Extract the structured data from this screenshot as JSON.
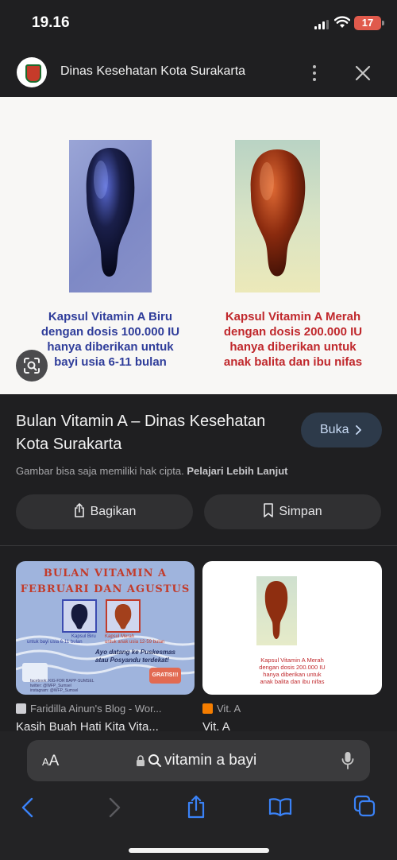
{
  "status_bar": {
    "time": "19.16",
    "battery": "17"
  },
  "site": {
    "name": "Dinas Kesehatan Kota Surakarta"
  },
  "image": {
    "left_caption": [
      "Kapsul Vitamin A Biru",
      "dengan dosis 100.000 IU",
      "hanya diberikan untuk",
      "bayi usia 6-11 bulan"
    ],
    "right_caption": [
      "Kapsul Vitamin A Merah",
      "dengan dosis 200.000 IU",
      "hanya diberikan untuk",
      "anak balita  dan ibu nifas"
    ]
  },
  "result": {
    "title": "Bulan Vitamin A – Dinas Kesehatan Kota Surakarta",
    "open_label": "Buka",
    "notice": "Gambar bisa saja memiliki hak cipta.",
    "notice_link": "Pelajari Lebih Lanjut",
    "share_label": "Bagikan",
    "save_label": "Simpan"
  },
  "related": [
    {
      "source": "Faridilla Ainun's Blog - Wor...",
      "title": "Kasih Buah Hati Kita Vita...",
      "image_text": {
        "line1": "BULAN VITAMIN A",
        "line2": "FEBRUARI DAN AGUSTUS",
        "blue_label": [
          "Kapsul Biru",
          "untuk bayi usia 6-11 bulan"
        ],
        "red_label": [
          "Kapsul Merah",
          "untuk anak usia 12-59 bulan"
        ],
        "note": [
          "Ayo datang ke Puskesmas",
          "atau Posyandu terdekat!"
        ],
        "badge": "GRATIS!!!",
        "credit": [
          "facebook: KIG-FDR BAPP-SUMSEL",
          "twitter: @WFP_Sumsel",
          "instagram: @WFP_Sumsel"
        ]
      }
    },
    {
      "source": "Vit. A",
      "title": "Vit. A",
      "image_text": {
        "caption": [
          "Kapsul Vitamin A Merah",
          "dengan dosis 200.000 IU",
          "hanya diberikan untuk",
          "anak balita  dan ibu nifas"
        ]
      }
    }
  ],
  "browser": {
    "aa_label": "AA",
    "url_text": "vitamin a bayi"
  },
  "colors": {
    "accent_blue": "#3a82f7",
    "caption_blue": "#2f3d9a",
    "caption_red": "#c0282c"
  }
}
